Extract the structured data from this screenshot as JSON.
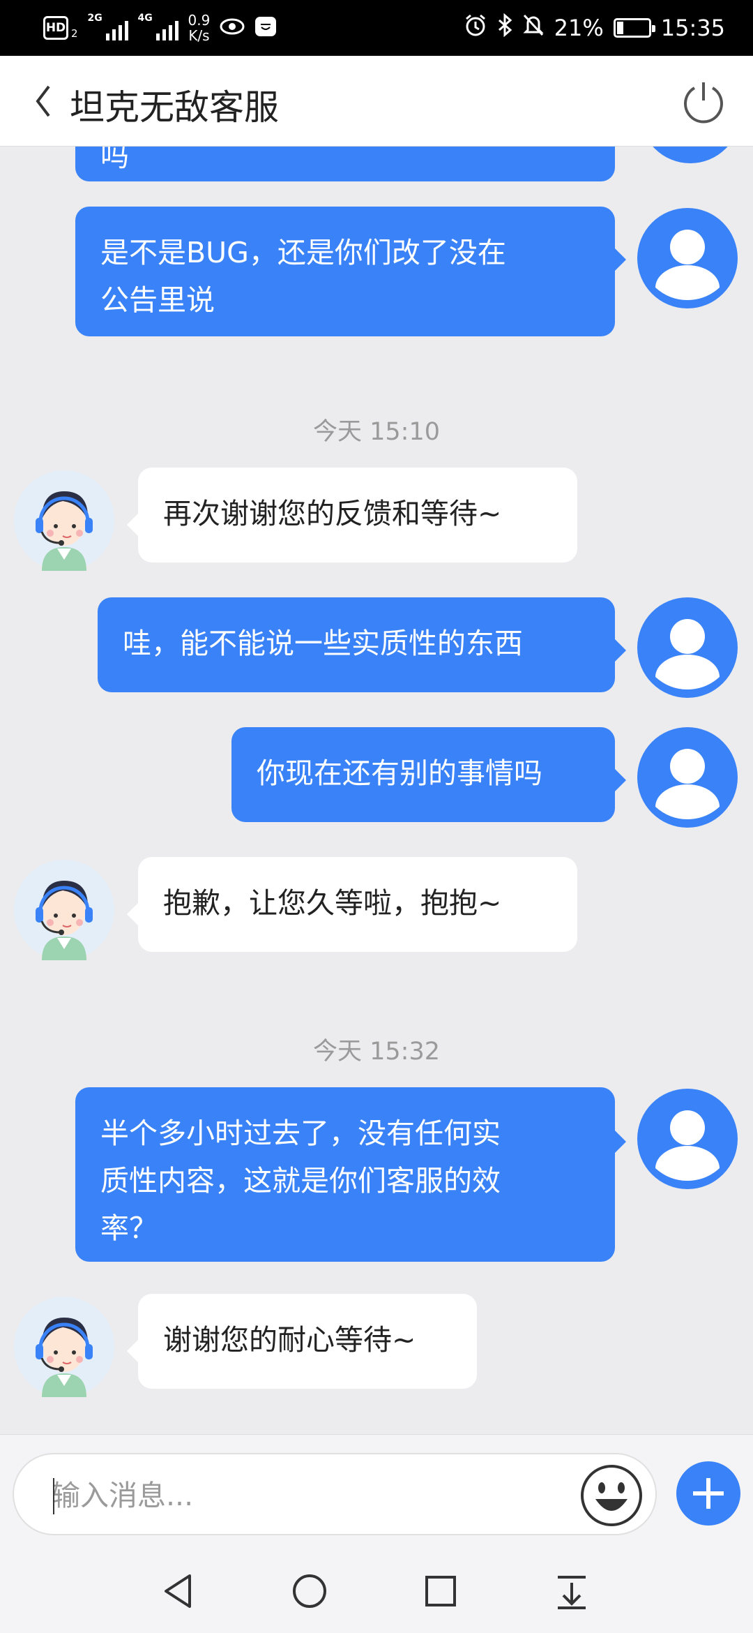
{
  "status_bar": {
    "hd_label": "HD",
    "hd_sub": "2",
    "signal1_label": "2G",
    "signal2_label": "4G",
    "net_speed_value": "0.9",
    "net_speed_unit": "K/s",
    "battery_percent": "21%",
    "battery_level": 0.21,
    "time": "15:35",
    "icons": [
      "eye-icon",
      "huawei-app-icon",
      "alarm-icon",
      "bluetooth-icon",
      "mute-bell-icon",
      "battery-icon"
    ]
  },
  "header": {
    "title": "坦克无敌客服",
    "icons": [
      "back-arrow-icon",
      "power-icon"
    ]
  },
  "messages": [
    {
      "sender": "user",
      "text": "吗"
    },
    {
      "sender": "user",
      "lines": [
        "是不是BUG，还是你们改了没在",
        "公告里说"
      ]
    },
    {
      "type": "time",
      "text": "今天 15:10"
    },
    {
      "sender": "agent",
      "text": "再次谢谢您的反馈和等待~"
    },
    {
      "sender": "user",
      "text": "哇，能不能说一些实质性的东西"
    },
    {
      "sender": "user",
      "text": "你现在还有别的事情吗"
    },
    {
      "sender": "agent",
      "text": "抱歉，让您久等啦，抱抱~"
    },
    {
      "type": "time",
      "text": "今天 15:32"
    },
    {
      "sender": "user",
      "lines": [
        "半个多小时过去了，没有任何实",
        "质性内容，这就是你们客服的效",
        "率？"
      ]
    },
    {
      "sender": "agent",
      "text": "谢谢您的耐心等待~"
    }
  ],
  "input": {
    "placeholder": "输入消息...",
    "value": ""
  },
  "nav": {
    "icons": [
      "back-triangle-icon",
      "home-circle-icon",
      "recents-square-icon",
      "notification-pulldown-icon"
    ]
  },
  "colors": {
    "user_bubble": "#3a82f7",
    "agent_bubble": "#ffffff",
    "chat_bg": "#ececef"
  }
}
